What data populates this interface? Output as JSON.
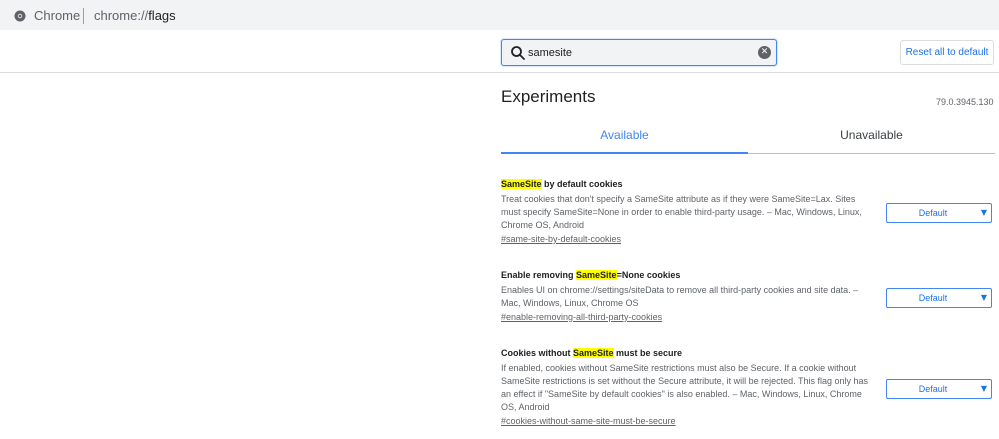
{
  "browser": {
    "site_chip": "Chrome",
    "url_scheme": "chrome://",
    "url_path": "flags"
  },
  "search": {
    "value": "samesite",
    "clear_glyph": "✕"
  },
  "reset_label": "Reset all to default",
  "title": "Experiments",
  "version": "79.0.3945.130",
  "tabs": [
    {
      "label": "Available",
      "active": true
    },
    {
      "label": "Unavailable",
      "active": false
    }
  ],
  "experiments": [
    {
      "name_before": "",
      "name_highlight": "SameSite",
      "name_after": " by default cookies",
      "description": "Treat cookies that don't specify a SameSite attribute as if they were SameSite=Lax. Sites must specify SameSite=None in order to enable third-party usage. – Mac, Windows, Linux, Chrome OS, Android",
      "link": "#same-site-by-default-cookies",
      "select_value": "Default"
    },
    {
      "name_before": "Enable removing ",
      "name_highlight": "SameSite",
      "name_after": "=None cookies",
      "description": "Enables UI on chrome://settings/siteData to remove all third-party cookies and site data. – Mac, Windows, Linux, Chrome OS",
      "link": "#enable-removing-all-third-party-cookies",
      "select_value": "Default"
    },
    {
      "name_before": "Cookies without ",
      "name_highlight": "SameSite",
      "name_after": " must be secure",
      "description": "If enabled, cookies without SameSite restrictions must also be Secure. If a cookie without SameSite restrictions is set without the Secure attribute, it will be rejected. This flag only has an effect if \"SameSite by default cookies\" is also enabled. – Mac, Windows, Linux, Chrome OS, Android",
      "link": "#cookies-without-same-site-must-be-secure",
      "select_value": "Default"
    }
  ],
  "select_arrow": "▼",
  "colors": {
    "accent": "#4285f4",
    "highlight": "#ffff00",
    "link_blue": "#1a73e8"
  },
  "icons": [
    "chrome-icon",
    "search-icon",
    "clear-icon",
    "dropdown-arrow-icon"
  ]
}
